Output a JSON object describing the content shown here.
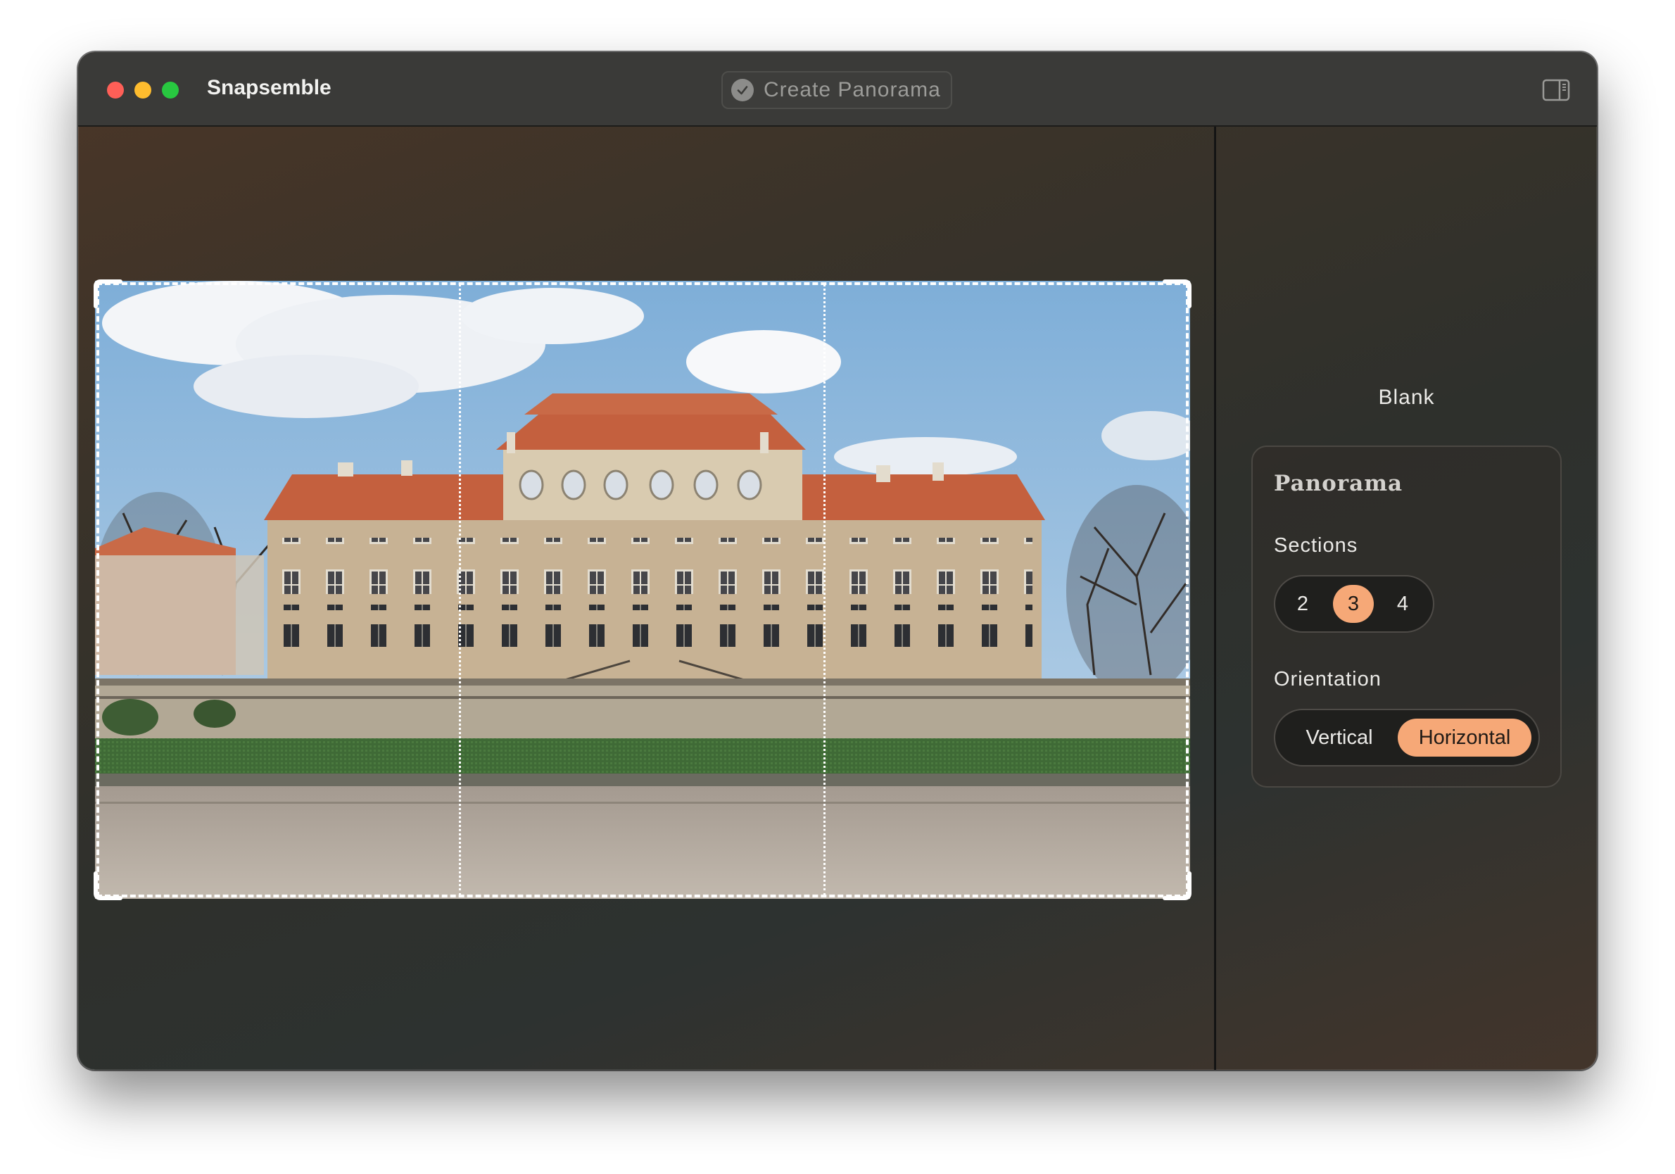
{
  "window": {
    "app_title": "Snapsemble",
    "create_button_label": "Create Panorama",
    "traffic_lights": [
      "close",
      "minimize",
      "maximize"
    ]
  },
  "canvas": {
    "image_description_icon": "photo-of-baroque-chateau",
    "sections_shown": 3
  },
  "sidebar": {
    "blank_label": "Blank",
    "panel": {
      "title": "Panorama",
      "sections": {
        "label": "Sections",
        "options": [
          "2",
          "3",
          "4"
        ],
        "selected": "3"
      },
      "orientation": {
        "label": "Orientation",
        "options": [
          "Vertical",
          "Horizontal"
        ],
        "selected": "Horizontal"
      }
    }
  },
  "colors": {
    "accent": "#f6a877",
    "titlebar": "#3a3a38",
    "traffic_close": "#fe5f57",
    "traffic_minimize": "#febc2e",
    "traffic_maximize": "#28c840"
  }
}
